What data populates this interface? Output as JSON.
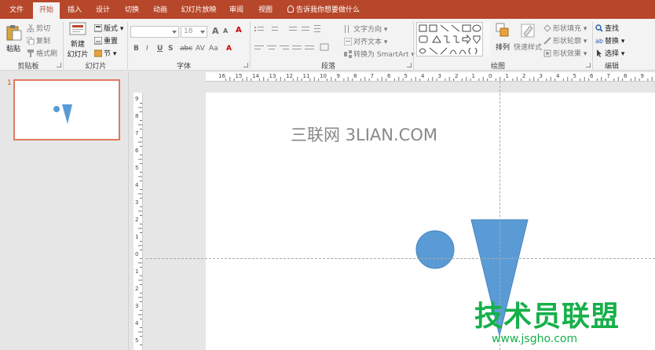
{
  "tabs": [
    {
      "label": "文件",
      "active": false
    },
    {
      "label": "开始",
      "active": true
    },
    {
      "label": "插入",
      "active": false
    },
    {
      "label": "设计",
      "active": false
    },
    {
      "label": "切换",
      "active": false
    },
    {
      "label": "动画",
      "active": false
    },
    {
      "label": "幻灯片放映",
      "active": false
    },
    {
      "label": "审阅",
      "active": false
    },
    {
      "label": "视图",
      "active": false
    }
  ],
  "tellme": "告诉我你想要做什么",
  "clipboard": {
    "paste": "粘贴",
    "cut": "剪切",
    "copy": "复制",
    "format_painter": "格式刷",
    "label": "剪贴板"
  },
  "slides_group": {
    "new_slide_line1": "新建",
    "new_slide_line2": "幻灯片",
    "layout": "版式",
    "reset": "重置",
    "section": "节",
    "label": "幻灯片"
  },
  "font_group": {
    "font_size": "18",
    "bold": "B",
    "italic": "I",
    "underline": "U",
    "shadow": "S",
    "strike": "abc",
    "spacing": "AV",
    "case": "Aa",
    "grow": "A",
    "shrink": "A",
    "label": "字体"
  },
  "paragraph_group": {
    "text_direction": "文字方向",
    "align_text": "对齐文本",
    "smartart": "转换为 SmartArt",
    "label": "段落"
  },
  "drawing_group": {
    "arrange": "排列",
    "quick_styles": "快速样式",
    "shape_fill": "形状填充",
    "shape_outline": "形状轮廓",
    "shape_effects": "形状效果",
    "label": "绘图"
  },
  "editing_group": {
    "find": "查找",
    "replace": "替换",
    "select": "选择",
    "label": "编辑"
  },
  "thumbnail": {
    "number": "1"
  },
  "ruler": {
    "horizontal": [
      "16",
      "15",
      "14",
      "13",
      "12",
      "11",
      "10",
      "9",
      "8",
      "7",
      "6",
      "5",
      "4",
      "3",
      "2",
      "1",
      "0",
      "1",
      "2",
      "3",
      "4",
      "5",
      "6",
      "7",
      "8",
      "9",
      "10",
      "11",
      "12",
      "13",
      "14",
      "15",
      "16"
    ],
    "vertical": [
      "9",
      "8",
      "7",
      "6",
      "5",
      "4",
      "3",
      "2",
      "1",
      "0",
      "1",
      "2",
      "3",
      "4",
      "5"
    ]
  },
  "slide": {
    "text": "三联网 3LIAN.COM",
    "shape_color": "#5b9bd5"
  },
  "watermark": {
    "big": "技术员联盟",
    "small": "www.jsgho.com"
  },
  "colors": {
    "accent": "#b7472a",
    "ribbon_bg": "#f3f3f3",
    "thumb_border": "#e07a5f",
    "shape": "#5b9bd5",
    "watermark": "#16b04a"
  }
}
